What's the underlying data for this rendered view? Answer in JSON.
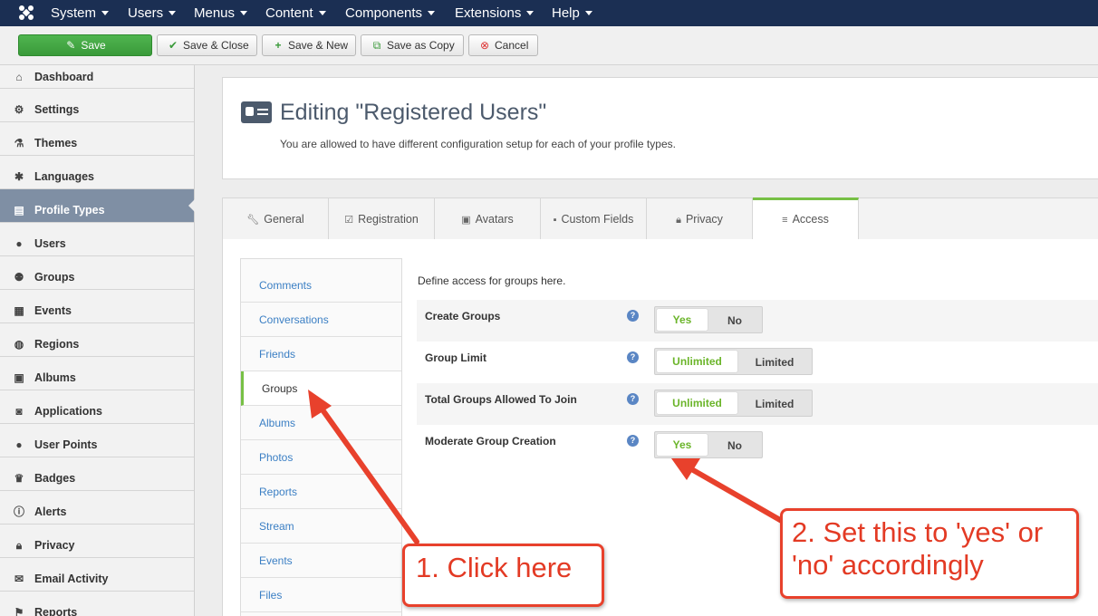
{
  "topbar": {
    "menus": [
      "System",
      "Users",
      "Menus",
      "Content",
      "Components",
      "Extensions",
      "Help"
    ]
  },
  "toolbar": {
    "save_label": "Save",
    "save_close_label": "Save & Close",
    "save_new_label": "Save & New",
    "save_copy_label": "Save as Copy",
    "cancel_label": "Cancel"
  },
  "sidebar": {
    "items": [
      {
        "label": "Dashboard",
        "icon": "home-icon"
      },
      {
        "label": "Settings",
        "icon": "gear-icon"
      },
      {
        "label": "Themes",
        "icon": "flask-icon"
      },
      {
        "label": "Languages",
        "icon": "puzzle-icon"
      },
      {
        "label": "Profile Types",
        "icon": "id-card-icon"
      },
      {
        "label": "Users",
        "icon": "user-icon"
      },
      {
        "label": "Groups",
        "icon": "users-icon"
      },
      {
        "label": "Events",
        "icon": "calendar-icon"
      },
      {
        "label": "Regions",
        "icon": "globe-icon"
      },
      {
        "label": "Albums",
        "icon": "image-icon"
      },
      {
        "label": "Applications",
        "icon": "camera-icon"
      },
      {
        "label": "User Points",
        "icon": "circle-icon"
      },
      {
        "label": "Badges",
        "icon": "crown-icon"
      },
      {
        "label": "Alerts",
        "icon": "alert-icon"
      },
      {
        "label": "Privacy",
        "icon": "lock-icon"
      },
      {
        "label": "Email Activity",
        "icon": "envelope-icon"
      },
      {
        "label": "Reports",
        "icon": "flag-icon"
      }
    ]
  },
  "header": {
    "title": "Editing \"Registered Users\"",
    "description": "You are allowed to have different configuration setup for each of your profile types."
  },
  "tabs": [
    {
      "label": "General",
      "icon": "wrench-icon"
    },
    {
      "label": "Registration",
      "icon": "checklist-icon"
    },
    {
      "label": "Avatars",
      "icon": "picture-icon"
    },
    {
      "label": "Custom Fields",
      "icon": "field-icon"
    },
    {
      "label": "Privacy",
      "icon": "lock-icon"
    },
    {
      "label": "Access",
      "icon": "database-icon"
    }
  ],
  "subnav": [
    "Comments",
    "Conversations",
    "Friends",
    "Groups",
    "Albums",
    "Photos",
    "Reports",
    "Stream",
    "Events",
    "Files"
  ],
  "access": {
    "description": "Define access for groups here.",
    "settings": [
      {
        "label": "Create Groups",
        "on": "Yes",
        "off": "No"
      },
      {
        "label": "Group Limit",
        "on": "Unlimited",
        "off": "Limited"
      },
      {
        "label": "Total Groups Allowed To Join",
        "on": "Unlimited",
        "off": "Limited"
      },
      {
        "label": "Moderate Group Creation",
        "on": "Yes",
        "off": "No"
      }
    ]
  },
  "callouts": {
    "first": "1. Click here",
    "second_line1": "2. Set this to 'yes' or",
    "second_line2": "'no' accordingly"
  },
  "colors": {
    "topbar": "#1b2f53",
    "save_green": "#46a546",
    "active_sidebar": "#7f8fa4",
    "accent_green": "#77c045",
    "link_blue": "#3b7fc4",
    "callout_red": "#e8412c"
  }
}
